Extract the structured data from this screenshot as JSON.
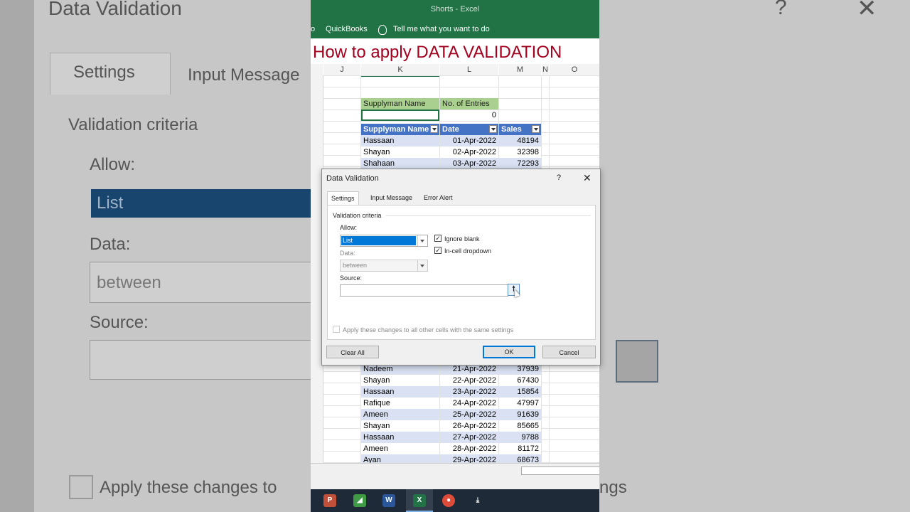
{
  "background": {
    "title": "Data Validation",
    "tab_settings": "Settings",
    "tab_input": "Input Message",
    "criteria": "Validation criteria",
    "allow": "Allow:",
    "list": "List",
    "data": "Data:",
    "between": "between",
    "source": "Source:",
    "apply": "Apply these changes to",
    "apply_tail": "ngs"
  },
  "excel": {
    "title": "Shorts  -  Excel",
    "ribbon_partial": "o",
    "quickbooks": "QuickBooks",
    "tell_me": "Tell me what you want to do",
    "heading": "How to apply DATA VALIDATION",
    "columns": [
      "J",
      "K",
      "L",
      "M",
      "N",
      "O"
    ],
    "summary": {
      "h1": "Supplyman Name",
      "h2": "No. of Entries",
      "v2": "0"
    },
    "table_headers": [
      "Supplyman Name",
      "Date",
      "Sales"
    ],
    "top_rows": [
      [
        "Hassaan",
        "01-Apr-2022",
        "48194"
      ],
      [
        "Shayan",
        "02-Apr-2022",
        "32398"
      ],
      [
        "Shahaan",
        "03-Apr-2022",
        "72293"
      ]
    ],
    "bottom_rows": [
      [
        "Nadeem",
        "21-Apr-2022",
        "37939"
      ],
      [
        "Shayan",
        "22-Apr-2022",
        "67430"
      ],
      [
        "Hassaan",
        "23-Apr-2022",
        "15854"
      ],
      [
        "Rafique",
        "24-Apr-2022",
        "47997"
      ],
      [
        "Ameen",
        "25-Apr-2022",
        "91639"
      ],
      [
        "Shayan",
        "26-Apr-2022",
        "85665"
      ],
      [
        "Hassaan",
        "27-Apr-2022",
        "9788"
      ],
      [
        "Ameen",
        "28-Apr-2022",
        "81172"
      ],
      [
        "Ayan",
        "29-Apr-2022",
        "68673"
      ]
    ]
  },
  "dialog": {
    "title": "Data Validation",
    "help": "?",
    "close": "✕",
    "tabs": [
      "Settings",
      "Input Message",
      "Error Alert"
    ],
    "criteria": "Validation criteria",
    "allow_label": "Allow:",
    "allow_value": "List",
    "ignore_blank": "Ignore blank",
    "in_cell_dropdown": "In-cell dropdown",
    "data_label": "Data:",
    "data_value": "between",
    "source_label": "Source:",
    "source_value": "",
    "apply_all": "Apply these changes to all other cells with the same settings",
    "clear_all": "Clear All",
    "ok": "OK",
    "cancel": "Cancel"
  },
  "taskbar": {
    "apps": [
      "pixpi-icon",
      "gimp-icon",
      "word-icon",
      "excel-icon",
      "chrome-icon",
      "download-icon"
    ]
  }
}
